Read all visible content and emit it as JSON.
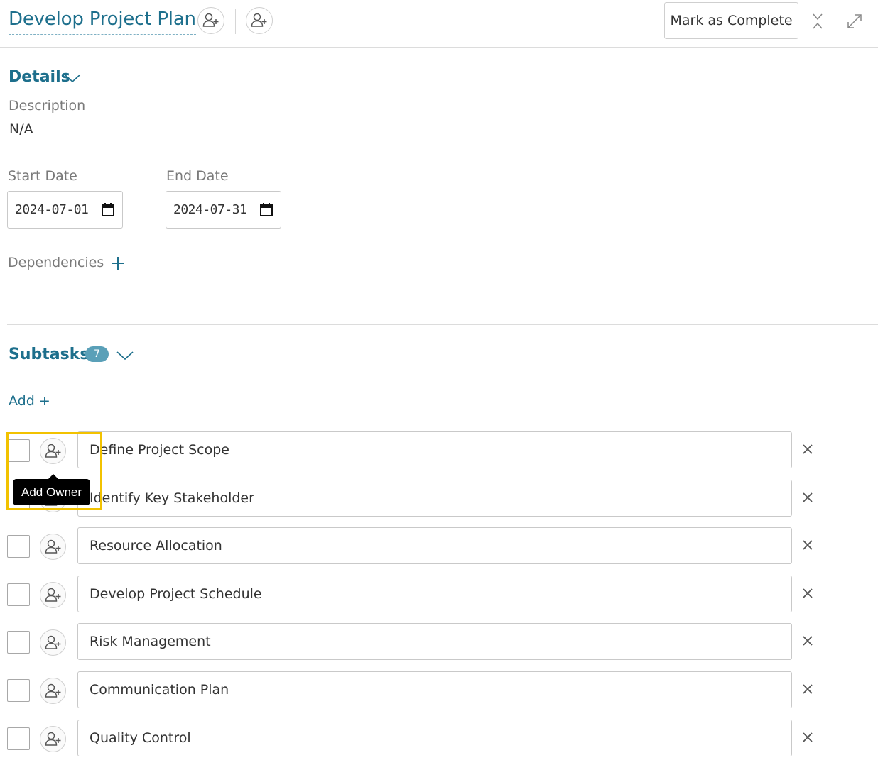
{
  "header": {
    "title": "Develop Project Plan",
    "complete_label": "Mark as Complete",
    "icons": [
      "add-owner-icon",
      "add-follower-icon",
      "collapse-icon",
      "expand-icon"
    ]
  },
  "details": {
    "title": "Details",
    "description_label": "Description",
    "description_value": "N/A",
    "start_label": "Start Date",
    "start_value": "2024-07-01",
    "end_label": "End Date",
    "end_value": "2024-07-31",
    "dependencies_label": "Dependencies"
  },
  "subtasks": {
    "title": "Subtasks",
    "count": "7",
    "add_label": "Add +",
    "tooltip": "Add Owner",
    "items": [
      {
        "label": "Define Project Scope"
      },
      {
        "label": "Identify Key Stakeholder"
      },
      {
        "label": "Resource Allocation"
      },
      {
        "label": "Develop Project Schedule"
      },
      {
        "label": "Risk Management"
      },
      {
        "label": "Communication Plan"
      },
      {
        "label": "Quality Control"
      }
    ]
  },
  "colors": {
    "accent": "#1d6f8c",
    "badge": "#5aa0b8",
    "highlight": "#f2c200"
  }
}
